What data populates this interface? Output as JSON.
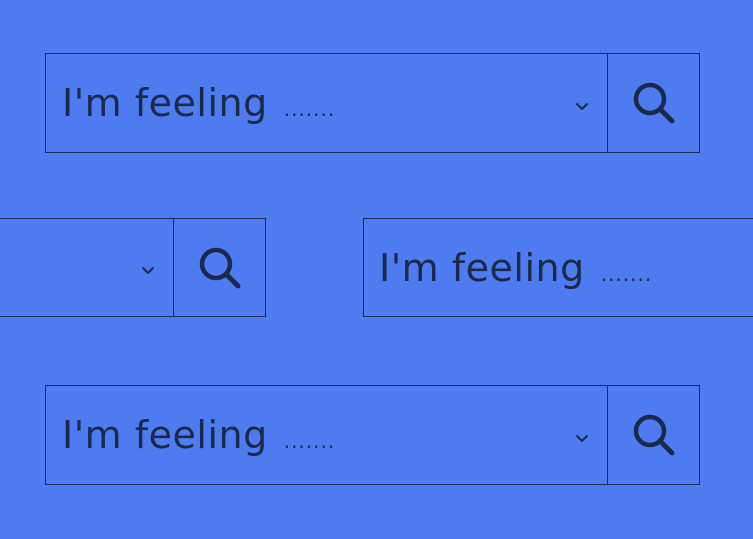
{
  "colors": {
    "background": "#4f7bf0",
    "border": "#1e2b55",
    "text": "#1b2a4a"
  },
  "search_bars": [
    {
      "label": "I'm feeling",
      "placeholder_dots": ".......",
      "dropdown_icon": "chevron-down-icon",
      "button_icon": "search-icon"
    },
    {
      "label": "",
      "placeholder_dots": "",
      "dropdown_icon": "chevron-down-icon",
      "button_icon": "search-icon"
    },
    {
      "label": "I'm feeling",
      "placeholder_dots": ".......",
      "dropdown_icon": "",
      "button_icon": ""
    },
    {
      "label": "I'm feeling",
      "placeholder_dots": ".......",
      "dropdown_icon": "chevron-down-icon",
      "button_icon": "search-icon"
    }
  ]
}
